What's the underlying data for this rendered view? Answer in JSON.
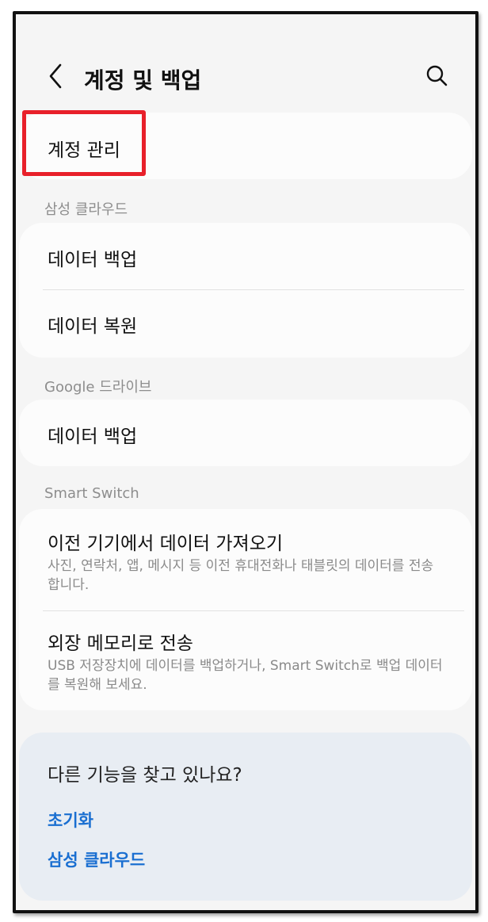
{
  "header": {
    "title": "계정 및 백업",
    "back_icon": "chevron-left-icon",
    "search_icon": "search-icon"
  },
  "account": {
    "manage_label": "계정 관리"
  },
  "samsung_cloud": {
    "section_label": "삼성 클라우드",
    "items": [
      {
        "label": "데이터 백업"
      },
      {
        "label": "데이터 복원"
      }
    ]
  },
  "google_drive": {
    "section_label": "Google 드라이브",
    "items": [
      {
        "label": "데이터 백업"
      }
    ]
  },
  "smart_switch": {
    "section_label": "Smart Switch",
    "items": [
      {
        "label": "이전 기기에서 데이터 가져오기",
        "description": "사진, 연락처, 앱, 메시지 등 이전 휴대전화나 태블릿의 데이터를 전송합니다."
      },
      {
        "label": "외장 메모리로 전송",
        "description": "USB 저장장치에 데이터를 백업하거나, Smart Switch로 백업 데이터를 복원해 보세요."
      }
    ]
  },
  "more": {
    "title": "다른 기능을 찾고 있나요?",
    "links": [
      {
        "label": "초기화"
      },
      {
        "label": "삼성 클라우드"
      }
    ]
  },
  "colors": {
    "highlight": "#e8202a",
    "link": "#1a6fd1",
    "background": "#f5f5f5"
  }
}
